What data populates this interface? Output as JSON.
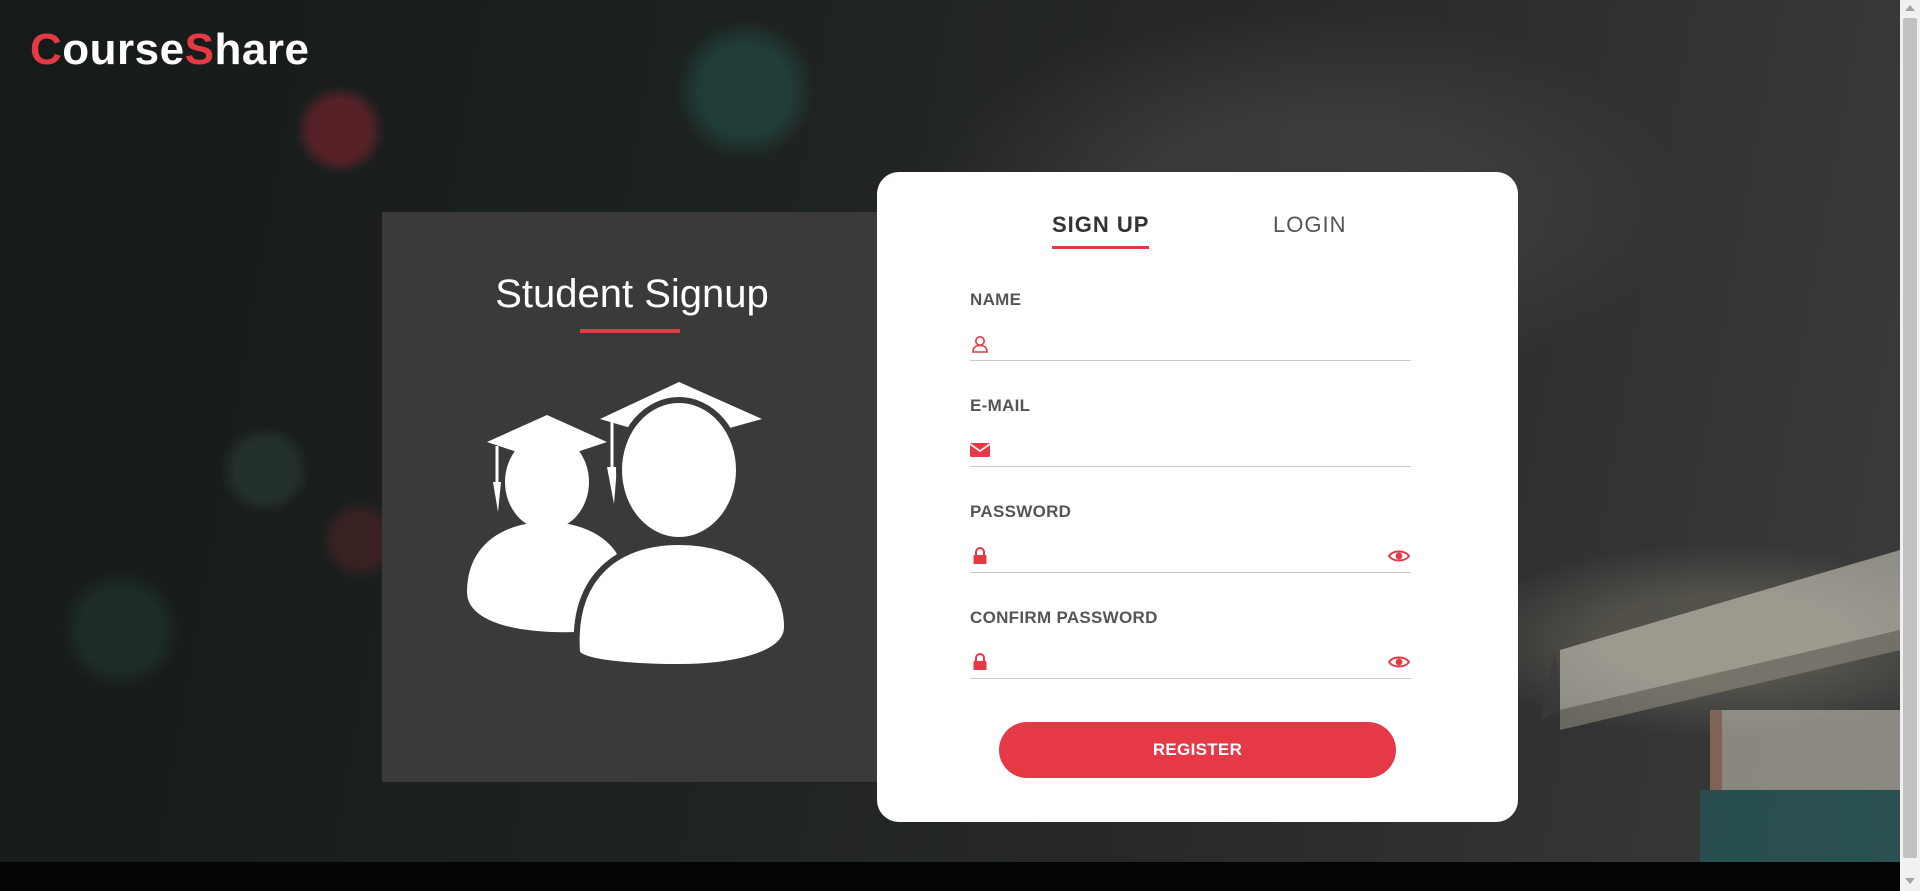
{
  "brand": {
    "logo_first_letter": "C",
    "logo_first_rest": "ourse",
    "logo_second_letter": "S",
    "logo_second_rest": "hare"
  },
  "left_panel": {
    "title": "Student Signup",
    "illustration_icon": "graduates-icon"
  },
  "tabs": [
    {
      "label": "SIGN UP",
      "active": true
    },
    {
      "label": "LOGIN",
      "active": false
    }
  ],
  "form": {
    "name": {
      "label": "NAME",
      "value": "",
      "icon": "user-icon"
    },
    "email": {
      "label": "E-MAIL",
      "value": "",
      "icon": "envelope-icon"
    },
    "password": {
      "label": "PASSWORD",
      "value": "",
      "icon": "lock-icon",
      "toggle_icon": "eye-icon"
    },
    "confirm_password": {
      "label": "CONFIRM PASSWORD",
      "value": "",
      "icon": "lock-icon",
      "toggle_icon": "eye-icon"
    },
    "submit_label": "REGISTER"
  },
  "colors": {
    "accent": "#e63946",
    "card": "#ffffff",
    "panel": "#3a3a3a"
  }
}
